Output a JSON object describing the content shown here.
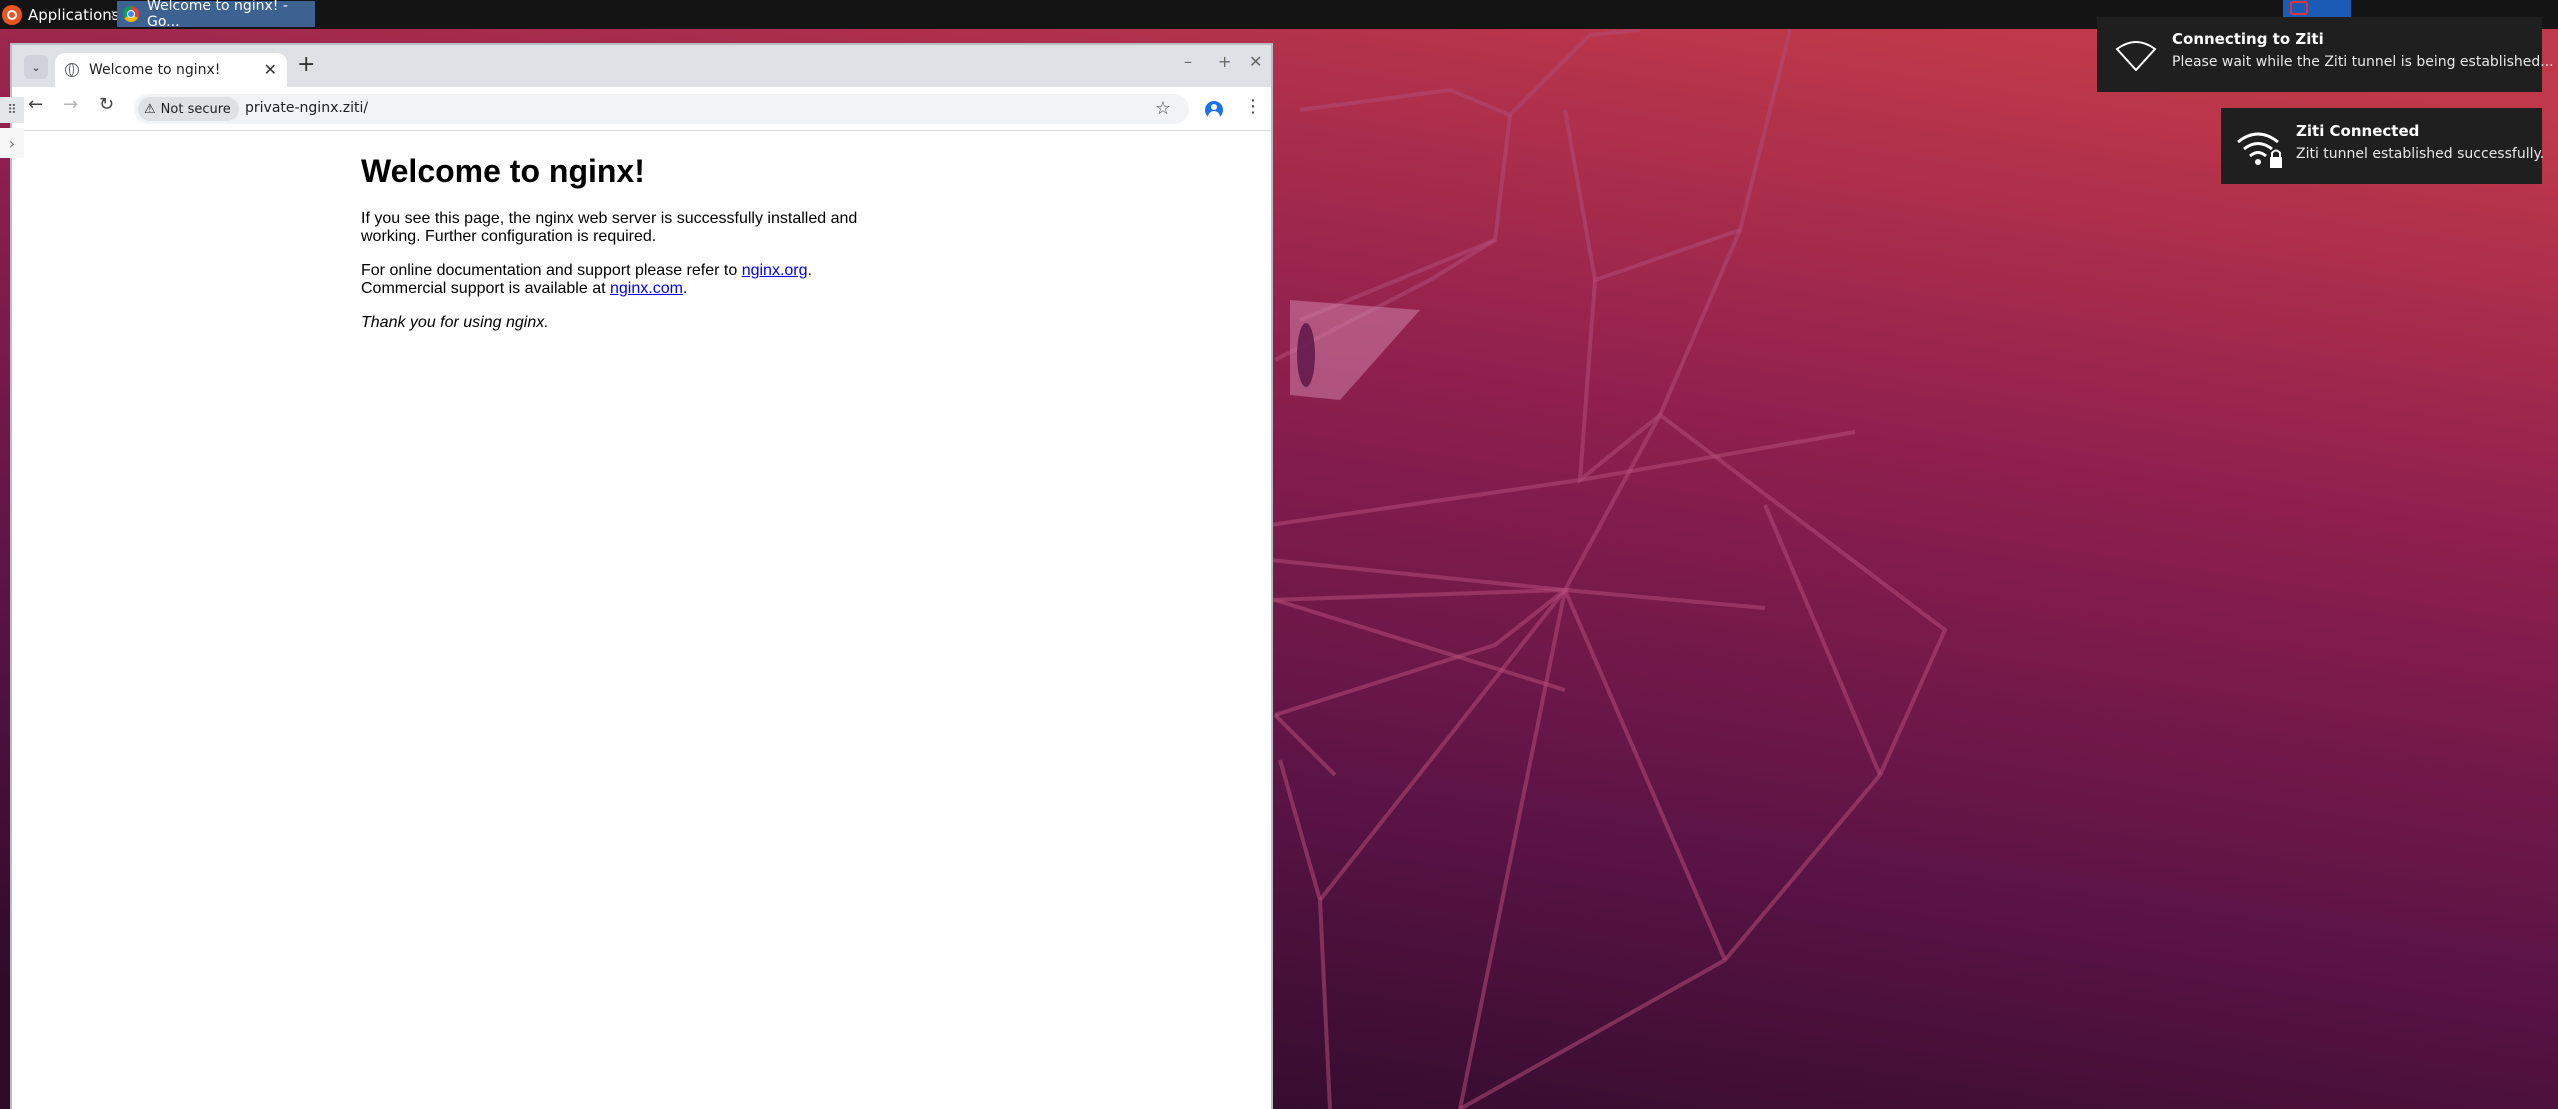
{
  "panel": {
    "applications_label": "Applications",
    "separator": ":",
    "task_title": "Welcome to nginx! - Go..."
  },
  "browser": {
    "tab_title": "Welcome to nginx!",
    "tab_close": "✕",
    "new_tab": "+",
    "minimize": "–",
    "maximize": "+",
    "close": "✕",
    "security_label": "Not secure",
    "url": "private-nginx.ziti/"
  },
  "page": {
    "heading": "Welcome to nginx!",
    "para1": "If you see this page, the nginx web server is successfully installed and working. Further configuration is required.",
    "para2_prefix": "For online documentation and support please refer to ",
    "link1": "nginx.org",
    "para2_mid": ". Commercial support is available at ",
    "link2": "nginx.com",
    "para2_suffix": ".",
    "thanks": "Thank you for using nginx."
  },
  "notifications": [
    {
      "title": "Connecting to Ziti",
      "body": "Please wait while the Ziti tunnel is being established...",
      "icon": "wifi-outline-icon"
    },
    {
      "title": "Ziti Connected",
      "body": "Ziti tunnel established successfully.",
      "icon": "wifi-lock-icon"
    }
  ],
  "colors": {
    "panel": "#141414",
    "task_active": "#3d6190",
    "wallpaper_top": "#b83a4b",
    "wallpaper_bottom": "#2c0d25",
    "link": "#0000ee"
  }
}
